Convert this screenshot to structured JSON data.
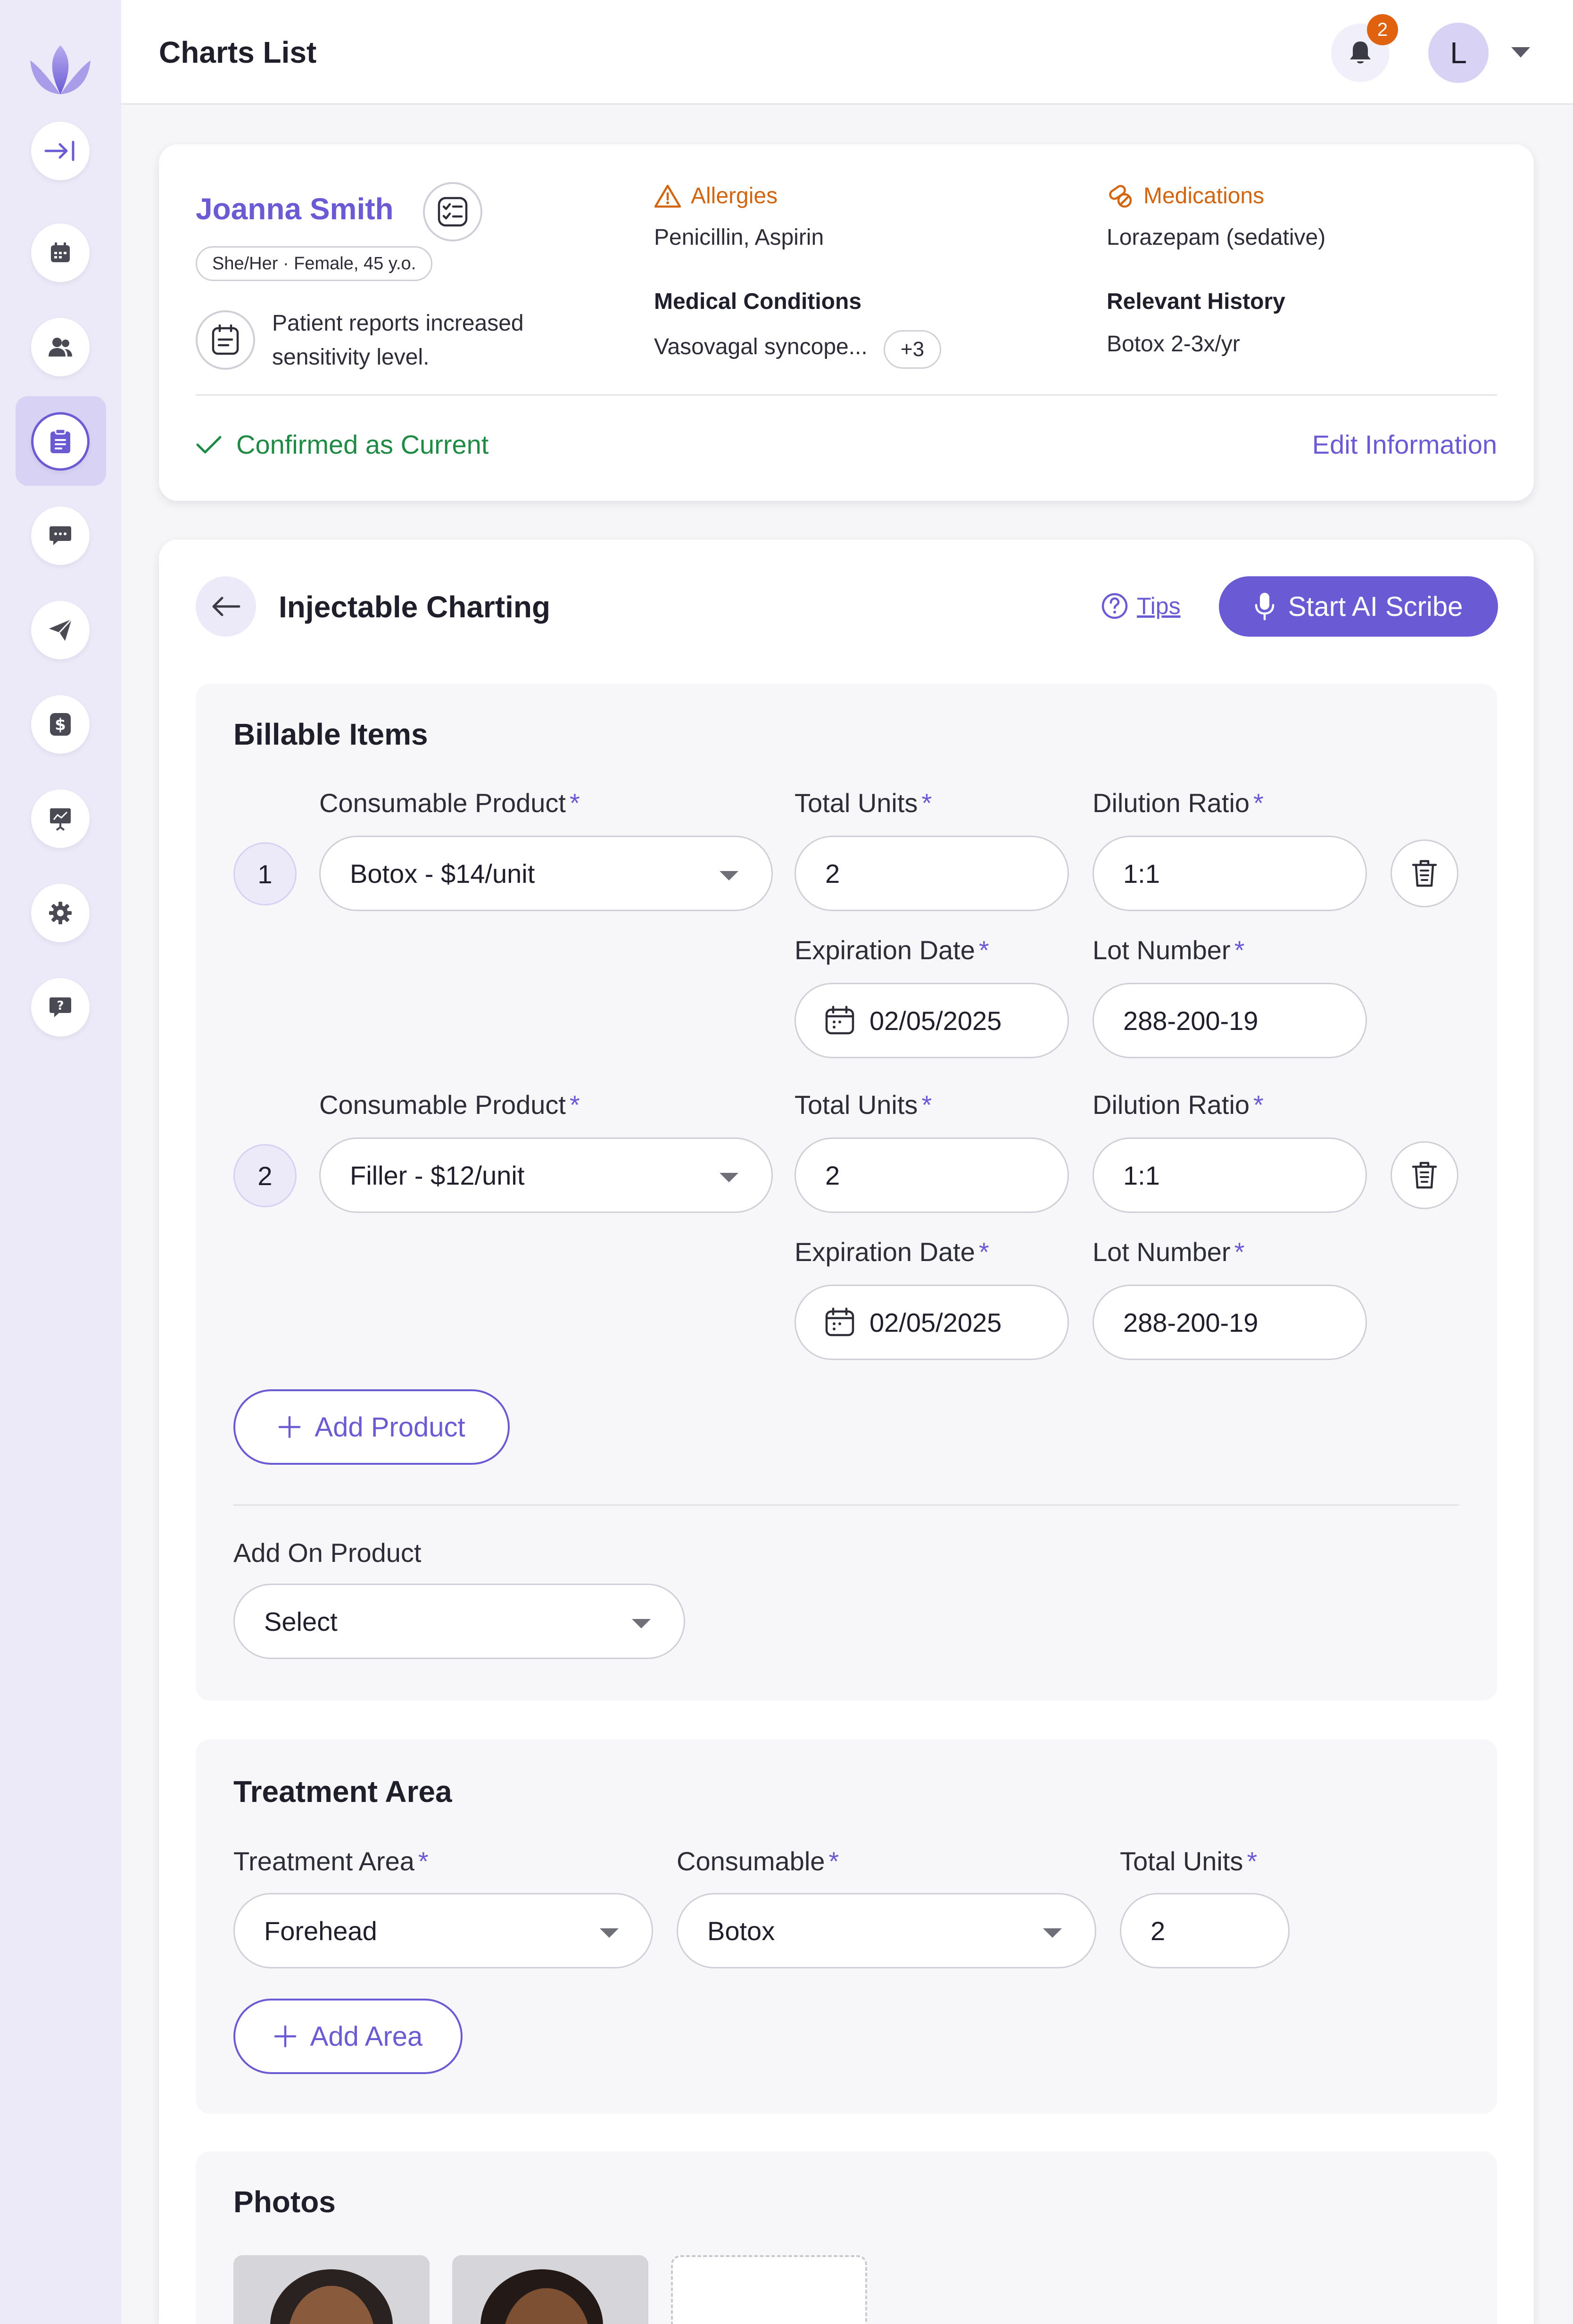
{
  "header": {
    "title": "Charts List",
    "notification_count": "2",
    "avatar_initial": "L"
  },
  "sidebar": {
    "items": [
      {
        "icon": "collapse-sidebar-icon"
      },
      {
        "icon": "calendar-icon"
      },
      {
        "icon": "users-icon"
      },
      {
        "icon": "clipboard-icon",
        "active": true
      },
      {
        "icon": "chat-icon"
      },
      {
        "icon": "send-icon"
      },
      {
        "icon": "dollar-icon"
      },
      {
        "icon": "presentation-chart-icon"
      },
      {
        "icon": "gear-icon"
      },
      {
        "icon": "help-chat-icon"
      }
    ]
  },
  "patient": {
    "name": "Joanna Smith",
    "pronouns_info": "She/Her · Female, 45 y.o.",
    "note": "Patient reports increased sensitivity level.",
    "allergies_label": "Allergies",
    "allergies_value": "Penicillin, Aspirin",
    "medications_label": "Medications",
    "medications_value": "Lorazepam (sedative)",
    "conditions_label": "Medical Conditions",
    "conditions_value": "Vasovagal syncope...",
    "conditions_more": "+3",
    "history_label": "Relevant History",
    "history_value": "Botox 2-3x/yr",
    "confirmed_text": "Confirmed as Current",
    "edit_link": "Edit Information"
  },
  "charting": {
    "title": "Injectable Charting",
    "tips_label": "Tips",
    "scribe_label": "Start AI Scribe",
    "billable": {
      "title": "Billable Items",
      "labels": {
        "product": "Consumable Product",
        "units": "Total Units",
        "dilution": "Dilution Ratio",
        "expiration": "Expiration Date",
        "lot": "Lot Number",
        "required": "*"
      },
      "items": [
        {
          "num": "1",
          "product": "Botox - $14/unit",
          "units": "2",
          "dilution": "1:1",
          "expiration": "02/05/2025",
          "lot": "288-200-19"
        },
        {
          "num": "2",
          "product": "Filler - $12/unit",
          "units": "2",
          "dilution": "1:1",
          "expiration": "02/05/2025",
          "lot": "288-200-19"
        }
      ],
      "add_product": "Add Product",
      "add_on_label": "Add On Product",
      "add_on_value": "Select"
    },
    "treatment": {
      "title": "Treatment Area",
      "area_label": "Treatment Area",
      "consumable_label": "Consumable",
      "units_label": "Total Units",
      "area_value": "Forehead",
      "consumable_value": "Botox",
      "units_value": "2",
      "add_area": "Add Area"
    },
    "photos": {
      "title": "Photos"
    }
  },
  "colors": {
    "accent": "#6a5bd4",
    "warning": "#d2650f",
    "success": "#1e8a44"
  }
}
